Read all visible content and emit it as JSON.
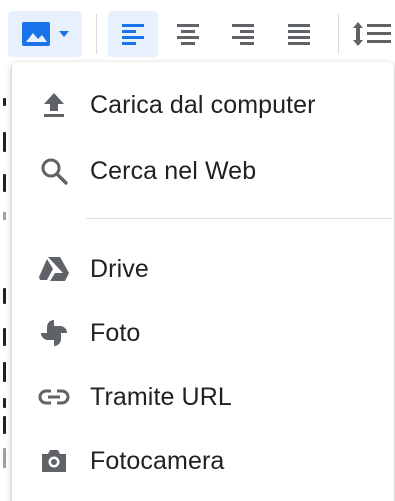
{
  "toolbar": {
    "buttons": [
      {
        "icon": "insert-image-icon",
        "active": true
      },
      {
        "icon": "align-left-icon",
        "active": true
      },
      {
        "icon": "align-center-icon",
        "active": false
      },
      {
        "icon": "align-right-icon",
        "active": false
      },
      {
        "icon": "align-justify-icon",
        "active": false
      },
      {
        "icon": "line-spacing-icon",
        "active": false
      }
    ]
  },
  "menu": {
    "items": [
      {
        "label": "Carica dal computer",
        "icon": "upload-icon"
      },
      {
        "label": "Cerca nel Web",
        "icon": "search-icon"
      },
      {
        "label": "Drive",
        "icon": "drive-icon"
      },
      {
        "label": "Foto",
        "icon": "photos-icon"
      },
      {
        "label": "Tramite URL",
        "icon": "link-icon"
      },
      {
        "label": "Fotocamera",
        "icon": "camera-icon"
      }
    ]
  },
  "colors": {
    "accent": "#1a73e8",
    "icon": "#5f6368",
    "text": "#202124",
    "active_bg": "#e8f0fe"
  }
}
